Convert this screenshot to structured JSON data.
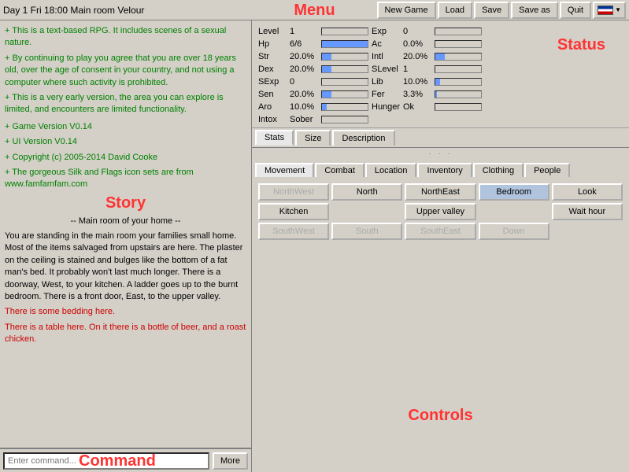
{
  "title": "Day 1  Fri 18:00  Main room  Velour",
  "menu_label": "Menu",
  "toolbar": {
    "new_game": "New Game",
    "load": "Load",
    "save": "Save",
    "save_as": "Save as",
    "quit": "Quit"
  },
  "story": {
    "label": "Story",
    "intro_lines": [
      "+ This is a text-based RPG. It includes scenes of a sexual nature.",
      "+ By continuing to play you agree that you are over 18 years old, over the age of consent in your country, and not using a computer where such activity is prohibited.",
      "+ This is a very early version, the area you can explore is limited, and encounters are limited functionality."
    ],
    "version_lines": [
      "+ Game Version V0.14",
      "+ UI Version V0.14",
      "+ Copyright (c) 2005-2014 David Cooke",
      "+ The gorgeous Silk and Flags icon sets are from www.famfamfam.com"
    ],
    "location_header": "-- Main room of your home --",
    "description": "You are standing in the main room your families small home. Most of the items salvaged from upstairs are here. The plaster on the ceiling is stained and bulges like the bottom of a fat man's bed. It probably won't last much longer. There is a doorway, West, to your kitchen. A ladder goes up to the burnt bedroom. There is a front door, East, to the upper valley.",
    "items": [
      "There is some bedding here.",
      "There is a table here. On it there is a bottle of beer, and a roast chicken."
    ]
  },
  "command": {
    "label": "Command",
    "placeholder": "Enter command...",
    "more_btn": "More"
  },
  "status": {
    "label": "Status",
    "stats": [
      {
        "name": "Level",
        "value": "1",
        "bar": 0
      },
      {
        "name": "Exp",
        "value": "0",
        "bar": 0
      },
      {
        "name": "Hp",
        "value": "6/6",
        "bar": 100
      },
      {
        "name": "Ac",
        "value": "0.0%",
        "bar": 0
      },
      {
        "name": "Str",
        "value": "20.0%",
        "bar": 20
      },
      {
        "name": "Intl",
        "value": "20.0%",
        "bar": 20
      },
      {
        "name": "Dex",
        "value": "20.0%",
        "bar": 20
      },
      {
        "name": "SLevel",
        "value": "1",
        "bar": 0
      },
      {
        "name": "SExp",
        "value": "0",
        "bar": 0
      },
      {
        "name": "Lib",
        "value": "10.0%",
        "bar": 10
      },
      {
        "name": "Sen",
        "value": "20.0%",
        "bar": 20
      },
      {
        "name": "Fer",
        "value": "3.3%",
        "bar": 3
      },
      {
        "name": "Aro",
        "value": "10.0%",
        "bar": 10
      },
      {
        "name": "Hunger",
        "value": "Ok",
        "bar": 0
      },
      {
        "name": "Intox",
        "value": "Sober",
        "bar": 0
      }
    ]
  },
  "info_tabs": [
    {
      "label": "Stats",
      "active": true
    },
    {
      "label": "Size",
      "active": false
    },
    {
      "label": "Description",
      "active": false
    }
  ],
  "controls": {
    "label": "Controls",
    "tabs": [
      {
        "label": "Movement",
        "active": true
      },
      {
        "label": "Combat",
        "active": false
      },
      {
        "label": "Location",
        "active": false
      },
      {
        "label": "Inventory",
        "active": false
      },
      {
        "label": "Clothing",
        "active": false
      },
      {
        "label": "People",
        "active": false
      }
    ],
    "movement_buttons": [
      {
        "label": "NorthWest",
        "enabled": false,
        "col": 1
      },
      {
        "label": "North",
        "enabled": true,
        "col": 2
      },
      {
        "label": "NorthEast",
        "enabled": true,
        "col": 3
      },
      {
        "label": "Bedroom",
        "enabled": true,
        "col": 4
      },
      {
        "label": "Look",
        "enabled": true,
        "col": 5
      },
      {
        "label": "Kitchen",
        "enabled": true,
        "col": 1
      },
      {
        "label": "",
        "enabled": false,
        "col": 2
      },
      {
        "label": "Upper valley",
        "enabled": true,
        "col": 3
      },
      {
        "label": "",
        "enabled": false,
        "col": 4
      },
      {
        "label": "Wait hour",
        "enabled": true,
        "col": 5
      },
      {
        "label": "SouthWest",
        "enabled": false,
        "col": 1
      },
      {
        "label": "South",
        "enabled": false,
        "col": 2
      },
      {
        "label": "SouthEast",
        "enabled": false,
        "col": 3
      },
      {
        "label": "Down",
        "enabled": false,
        "col": 4
      },
      {
        "label": "",
        "enabled": false,
        "col": 5
      }
    ]
  }
}
